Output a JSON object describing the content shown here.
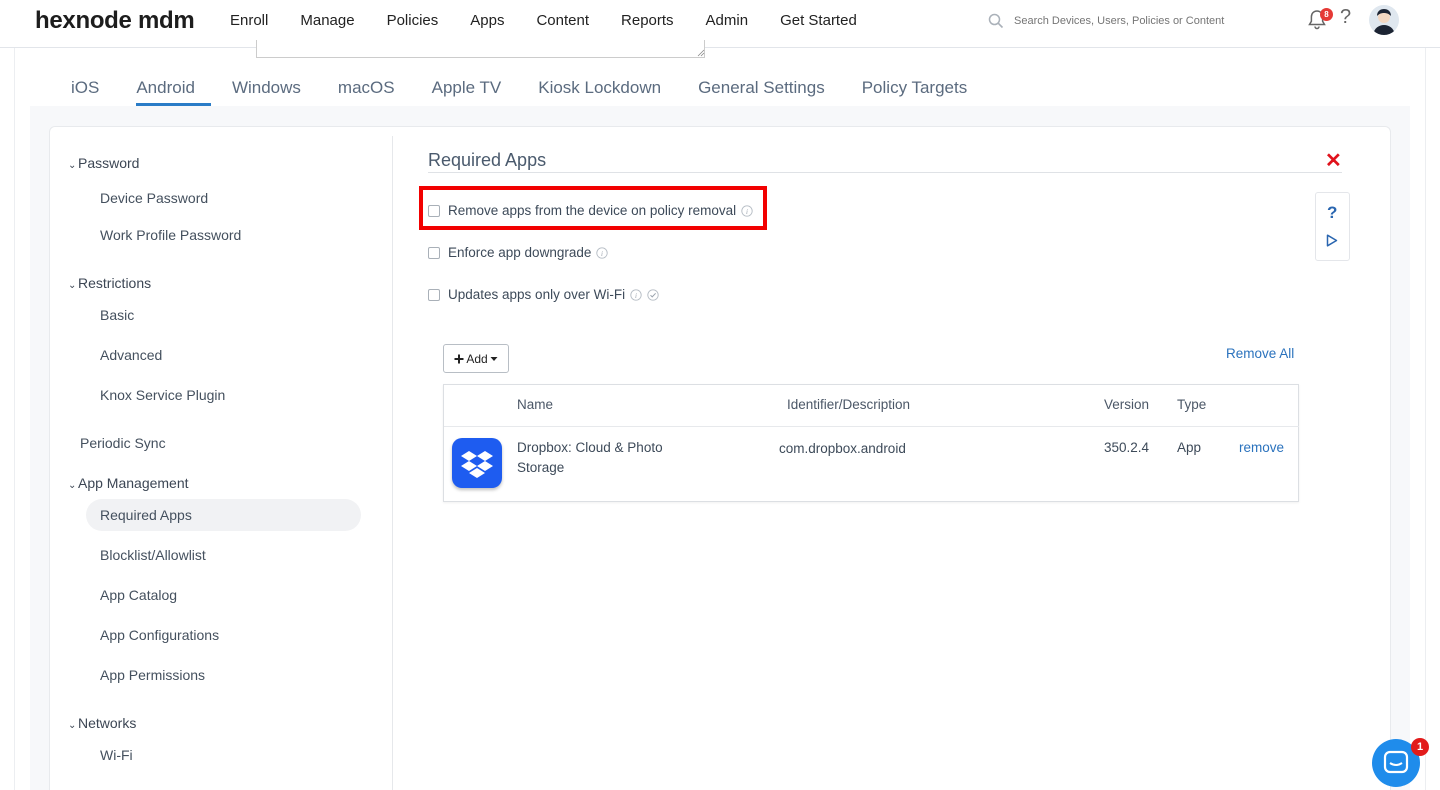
{
  "brand": {
    "logo_text": "hexnode mdm"
  },
  "top_nav": {
    "items": [
      {
        "label": "Enroll"
      },
      {
        "label": "Manage"
      },
      {
        "label": "Policies"
      },
      {
        "label": "Apps"
      },
      {
        "label": "Content"
      },
      {
        "label": "Reports"
      },
      {
        "label": "Admin"
      },
      {
        "label": "Get Started"
      }
    ],
    "active_index": 2,
    "search_placeholder": "Search Devices, Users, Policies or Content",
    "notification_count": "8",
    "help_label": "?"
  },
  "os_tabs": {
    "items": [
      "iOS",
      "Android",
      "Windows",
      "macOS",
      "Apple TV",
      "Kiosk Lockdown",
      "General Settings",
      "Policy Targets"
    ],
    "active": "Android"
  },
  "sidebar": {
    "groups": {
      "password": "Password",
      "restrictions": "Restrictions",
      "app_management": "App Management",
      "networks": "Networks"
    },
    "items": {
      "device_password": "Device Password",
      "work_profile_password": "Work Profile Password",
      "basic": "Basic",
      "advanced": "Advanced",
      "knox": "Knox Service Plugin",
      "periodic_sync": "Periodic Sync",
      "required_apps": "Required Apps",
      "blocklist": "Blocklist/Allowlist",
      "app_catalog": "App Catalog",
      "app_configurations": "App Configurations",
      "app_permissions": "App Permissions",
      "wifi": "Wi-Fi"
    },
    "active": "Required Apps"
  },
  "main": {
    "title": "Required Apps",
    "close_label": "✕",
    "options": {
      "remove_on_policy_removal": {
        "label": "Remove apps from the device on policy removal",
        "checked": false
      },
      "enforce_downgrade": {
        "label": "Enforce app downgrade",
        "checked": false
      },
      "wifi_only": {
        "label": "Updates apps only over Wi-Fi",
        "checked": false
      }
    },
    "add_button": "Add",
    "remove_all": "Remove All",
    "table": {
      "columns": [
        "Name",
        "Identifier/Description",
        "Version",
        "Type"
      ],
      "rows": [
        {
          "icon": "dropbox-icon",
          "name_line1": "Dropbox: Cloud & Photo",
          "name_line2": "Storage",
          "identifier": "com.dropbox.android",
          "version": "350.2.4",
          "type": "App",
          "action": "remove"
        }
      ]
    }
  },
  "side_tools": {
    "help": "?"
  },
  "chat": {
    "badge": "1"
  },
  "colors": {
    "accent": "#2a7cc7",
    "link": "#2a72bd",
    "highlight_border": "#f20000",
    "close": "#e0121c",
    "dropbox": "#1e5cf0",
    "chat": "#1f8ceb"
  }
}
